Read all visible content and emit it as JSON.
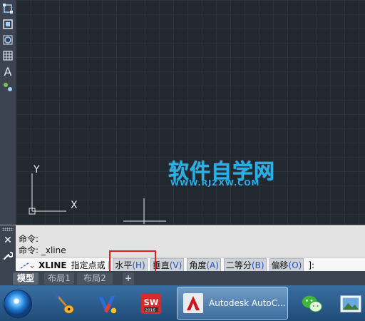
{
  "canvas": {
    "ucs_y_label": "Y",
    "ucs_x_label": "X",
    "watermark_title": "软件自学网",
    "watermark_url": "WWW.RJZXW.COM"
  },
  "command": {
    "history": [
      "命令:",
      "命令: _xline"
    ],
    "prompt_command": "XLINE",
    "prompt_text": "指定点或",
    "bracket_open": "[",
    "options": [
      {
        "label": "水平",
        "key": "(H)"
      },
      {
        "label": "垂直",
        "key": "(V)"
      },
      {
        "label": "角度",
        "key": "(A)"
      },
      {
        "label": "二等分",
        "key": "(B)"
      },
      {
        "label": "偏移",
        "key": "(O)"
      }
    ],
    "bracket_close": "]:"
  },
  "layout_tabs": [
    "模型",
    "布局1",
    "布局2",
    "+"
  ],
  "taskbar": {
    "active_app_label": "Autodesk AutoC..."
  },
  "colors": {
    "canvas_bg": "#212830",
    "watermark": "#27b0e8",
    "highlight": "#e02020",
    "option_key": "#1e4fcf"
  }
}
